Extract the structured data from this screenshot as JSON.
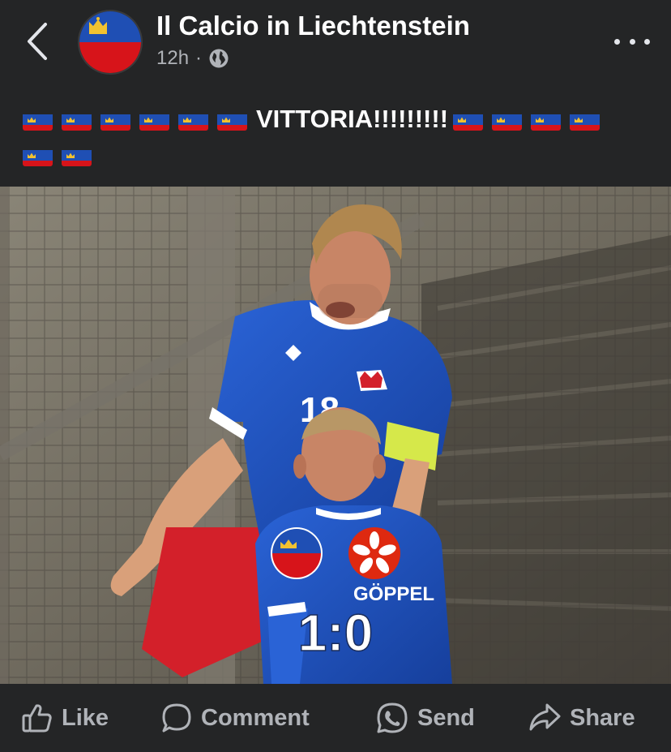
{
  "header": {
    "page_name": "Il Calcio in Liechtenstein",
    "time": "12h",
    "separator": "·",
    "audience_icon": "globe-icon",
    "back_icon": "chevron-left-icon",
    "more_icon": "more-horizontal-icon"
  },
  "post": {
    "text": "VITTORIA!!!!!!!!!",
    "flag_emoji_name": "flag-liechtenstein",
    "flags_before": 6,
    "flags_after": 6
  },
  "photo": {
    "jersey_number": "18",
    "player_name": "GÖPPEL",
    "score": "1:0",
    "home_badge": "liechtenstein-flag",
    "away_badge": "hong-kong-flag"
  },
  "actions": {
    "like_label": "Like",
    "comment_label": "Comment",
    "send_label": "Send",
    "share_label": "Share"
  },
  "colors": {
    "background": "#242526",
    "text_primary": "#ffffff",
    "text_secondary": "#b0b3b8",
    "lie_blue": "#1f4fb4",
    "lie_red": "#d7141a",
    "hk_red": "#de2910"
  }
}
